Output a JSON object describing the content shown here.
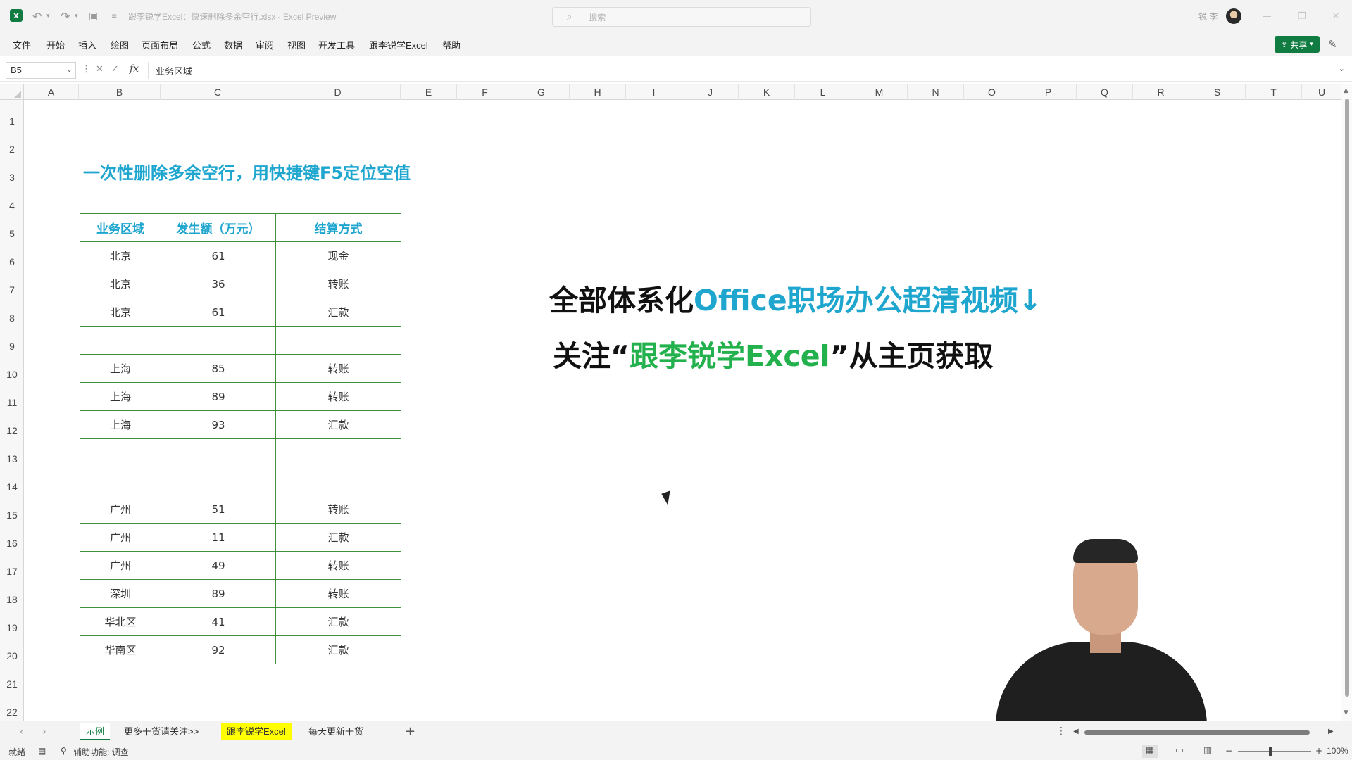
{
  "titlebar": {
    "doc_title": "跟李锐学Excel：快速删除多余空行.xlsx  -  Excel Preview",
    "search_placeholder": "搜索",
    "user_name": "锐 李"
  },
  "menu": [
    "文件",
    "开始",
    "插入",
    "绘图",
    "页面布局",
    "公式",
    "数据",
    "审阅",
    "视图",
    "开发工具",
    "跟李锐学Excel",
    "帮助"
  ],
  "share_label": "共享",
  "formula_bar": {
    "name_box": "B5",
    "fx": "fx",
    "content": "业务区域"
  },
  "columns": [
    "A",
    "B",
    "C",
    "D",
    "E",
    "F",
    "G",
    "H",
    "I",
    "J",
    "K",
    "L",
    "M",
    "N",
    "O",
    "P",
    "Q",
    "R",
    "S",
    "T",
    "U"
  ],
  "rows": [
    "1",
    "2",
    "3",
    "4",
    "5",
    "6",
    "7",
    "8",
    "9",
    "10",
    "11",
    "12",
    "13",
    "14",
    "15",
    "16",
    "17",
    "18",
    "19",
    "20",
    "21",
    "22"
  ],
  "sheet": {
    "title": "一次性删除多余空行，用快捷键F5定位空值",
    "table_headers": [
      "业务区域",
      "发生额（万元）",
      "结算方式"
    ],
    "table_rows": [
      [
        "北京",
        "61",
        "现金"
      ],
      [
        "北京",
        "36",
        "转账"
      ],
      [
        "北京",
        "61",
        "汇款"
      ],
      [
        "",
        "",
        ""
      ],
      [
        "上海",
        "85",
        "转账"
      ],
      [
        "上海",
        "89",
        "转账"
      ],
      [
        "上海",
        "93",
        "汇款"
      ],
      [
        "",
        "",
        ""
      ],
      [
        "",
        "",
        ""
      ],
      [
        "广州",
        "51",
        "转账"
      ],
      [
        "广州",
        "11",
        "汇款"
      ],
      [
        "广州",
        "49",
        "转账"
      ],
      [
        "深圳",
        "89",
        "转账"
      ],
      [
        "华北区",
        "41",
        "汇款"
      ],
      [
        "华南区",
        "92",
        "汇款"
      ]
    ]
  },
  "promo": {
    "line1_a": "全部体系化",
    "line1_b": "Office职场办公超清视频↓",
    "line2_a": "关注“",
    "line2_b": "跟李锐学Excel",
    "line2_c": "”从主页获取",
    "color_blue": "#1fa6cf",
    "color_green": "#22b14c"
  },
  "sheet_tabs": [
    "示例",
    "更多干货请关注>>",
    "跟李锐学Excel",
    "每天更新干货"
  ],
  "status": {
    "ready": "就绪",
    "accessibility": "辅助功能: 调查",
    "zoom": "100%"
  }
}
